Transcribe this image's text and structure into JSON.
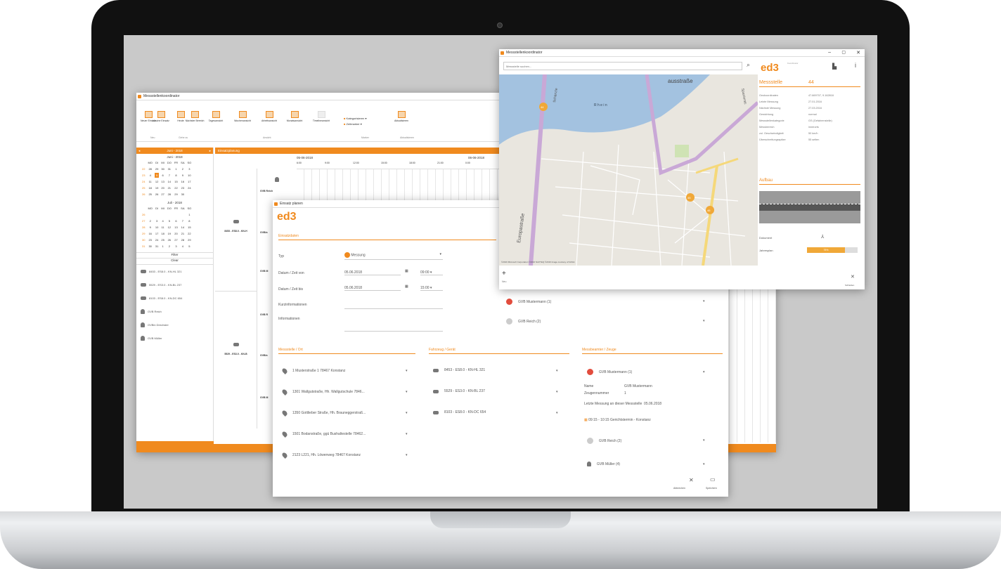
{
  "app": {
    "title": "Messstellenkoordinator"
  },
  "ribbon": {
    "buttons": [
      "Neuer Einsatz",
      "Lösche Einsatz",
      "Heute",
      "Nächster Bereich",
      "Tagesansicht",
      "Wochenansicht",
      "Arbeitsansicht",
      "Monatsansicht",
      "Timelineansicht",
      "Aktualisieren"
    ],
    "groups": [
      "Neu",
      "Gehe zu",
      "Ansicht",
      "Marker",
      "Aktualisieren"
    ],
    "kategorisieren": "Kategorisieren",
    "zeitmarker": "Zeitmarker"
  },
  "calendar": {
    "header": "Juni - 2018",
    "month1": "Juni - 2018",
    "month2": "Juli - 2018",
    "weekdays": [
      "MO",
      "DI",
      "MI",
      "DO",
      "FR",
      "SA",
      "SO"
    ],
    "june": [
      [
        "22",
        "28",
        "29",
        "30",
        "31",
        "1",
        "2",
        "3"
      ],
      [
        "23",
        "4",
        "5",
        "6",
        "7",
        "8",
        "9",
        "10"
      ],
      [
        "24",
        "11",
        "12",
        "13",
        "14",
        "15",
        "16",
        "17"
      ],
      [
        "25",
        "18",
        "19",
        "20",
        "21",
        "22",
        "23",
        "24"
      ],
      [
        "26",
        "25",
        "26",
        "27",
        "28",
        "29",
        "30",
        ""
      ]
    ],
    "july": [
      [
        "26",
        "",
        "",
        "",
        "",
        "",
        "",
        "1"
      ],
      [
        "27",
        "2",
        "3",
        "4",
        "5",
        "6",
        "7",
        "8"
      ],
      [
        "28",
        "9",
        "10",
        "11",
        "12",
        "13",
        "14",
        "15"
      ],
      [
        "29",
        "16",
        "17",
        "18",
        "19",
        "20",
        "21",
        "22"
      ],
      [
        "30",
        "23",
        "24",
        "25",
        "26",
        "27",
        "28",
        "29"
      ],
      [
        "31",
        "30",
        "31",
        "1",
        "2",
        "3",
        "4",
        "5"
      ]
    ]
  },
  "filter": {
    "filter": "Filter",
    "clear": "Clear",
    "items": [
      "8453 - ES8.0 - KN-HL 321",
      "5529 - ES3.0 - KN-BL 237",
      "8103 - ES8.0 - KN-DC 654",
      "GVB Reich",
      "GVBin Drechsler",
      "GVB Müller"
    ]
  },
  "schedule": {
    "title": "Einsatzplanung",
    "date1": "05-06-2018",
    "date2": "06-06-2018",
    "times": [
      "6:00",
      "9:00",
      "12:00",
      "15:00",
      "18:00",
      "21:00",
      "0:00"
    ],
    "vehicle1": "8453 - ES8.0 - KN-H",
    "vehicle2": "5529 - ES3.0 - KN-B",
    "rows": [
      "GVB Reich",
      "GVBin",
      "GVB M",
      "GVB R",
      "GVBin",
      "GVB M"
    ]
  },
  "einsatz": {
    "title": "Einsatz planen",
    "section": "Einsatzdaten",
    "typ_label": "Typ",
    "typ_value": "Messung",
    "from_label": "Datum / Zeit von",
    "from_date": "05.06.2018",
    "from_time": "09:00",
    "to_label": "Datum / Zeit bis",
    "to_date": "05.06.2018",
    "to_time": "15:00",
    "kurz_label": "Kurzinformationen",
    "info_label": "Informationen",
    "assigned": [
      "GVB Mustermann (1)",
      "GVB Reich (2)"
    ],
    "col1_title": "Messstelle / Ort",
    "col1": [
      "1 Musterstraße 1 78467 Konstanz",
      "1301 Wallgutstraße, Hh. Wallgutschule 7846...",
      "1350 Gottlieber Straße, Hh. Brauneggerstraß...",
      "1501 Bodanstraße, ggü Bushaltestelle 78462...",
      "2123 L221, Hh. Löwenweg 78467 Konstanz"
    ],
    "col2_title": "Fahrzeug / Gerät",
    "col2": [
      "8453 - ES8.0 - KN-HL 321",
      "5529 - ES3.0 - KN-BL 237",
      "8103 - ES8.0 - KN-DC 654"
    ],
    "col3_title": "Messbeamter / Zeuge",
    "col3_head": "GVB Mustermann (1)",
    "name_label": "Name",
    "name_value": "GVB Mustermann",
    "zeuge_label": "Zeugennummer",
    "zeuge_value": "1",
    "letzte": "Letzte Messung an dieser Messstelle",
    "letzte_date": "05.06.2018",
    "termin": "09:15 - 10:15 Gerichtstermin - Konstanz",
    "col3": [
      "GVB Reich (2)",
      "GVB Müller (4)"
    ],
    "cancel": "Abbrechen",
    "save": "Speichern"
  },
  "mapwin": {
    "title": "Messstellenkoordinator",
    "search_placeholder": "Messstelle suchen...",
    "brand_sub": "Koordinator",
    "messstelle_label": "Messstelle",
    "messstelle_value": "44",
    "props": [
      [
        "Geokoordinaten",
        "47.669707, 9.162818"
      ],
      [
        "Letzte Messung",
        "27.01.2016"
      ],
      [
        "Nächste Messung",
        "27.03.2016"
      ],
      [
        "Gewichtung",
        "normal"
      ],
      [
        "Messstellenkategorie",
        "GS (Gefahrenstelle)"
      ],
      [
        "Messbereich",
        "innerorts"
      ],
      [
        "zul. Geschwindigkeit",
        "50    km/h"
      ],
      [
        "Überschreitungsspitze",
        "55    selten"
      ]
    ],
    "aufbau": "Aufbau",
    "dokument": "Dokument",
    "jahresplan": "Jahresplan",
    "jahresplan_pct": "75%",
    "jahresplan_value": 0.75,
    "neu": "Neu",
    "schliessen": "Schließen",
    "map_labels": [
      "ausstraße",
      "R h e i n",
      "Europastraße",
      "Schänzle",
      "Spanierstr."
    ],
    "markers": [
      "44",
      "45",
      "46"
    ],
    "copyright": "©2016 Microsoft Corporation ©2016 NAVTEQ ©2016 Image courtesy of NASA"
  },
  "brand": "ed3",
  "colors": {
    "accent": "#f08a1e"
  }
}
